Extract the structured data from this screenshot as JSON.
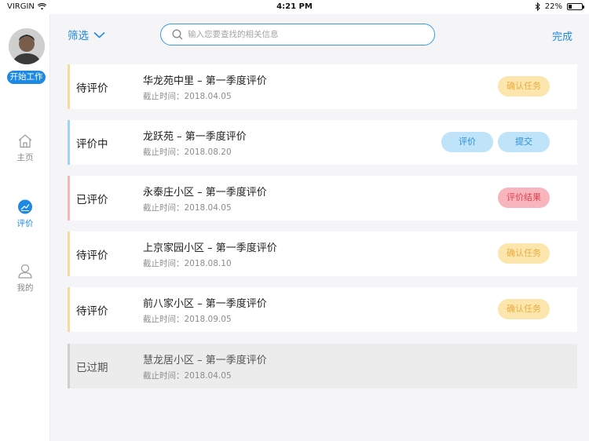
{
  "status_bar": {
    "carrier": "VIRGIN",
    "time": "4:21 PM",
    "battery": "22%",
    "battery_level": 0.22
  },
  "sidebar": {
    "start_button": "开始工作",
    "nav": [
      {
        "label": "主页",
        "icon": "home-icon",
        "active": false
      },
      {
        "label": "评价",
        "icon": "rating-icon",
        "active": true
      },
      {
        "label": "我的",
        "icon": "user-icon",
        "active": false
      }
    ]
  },
  "toolbar": {
    "filter_label": "筛选",
    "search_placeholder": "输入您要查找的相关信息",
    "done_label": "完成"
  },
  "tasks": [
    {
      "status": "待评价",
      "title": "华龙苑中里  –  第一季度评价",
      "deadline": "截止时间：2018.04.05",
      "actions": [
        "确认任务"
      ]
    },
    {
      "status": "评价中",
      "title": "龙跃苑  –  第一季度评价",
      "deadline": "截止时间：2018.08.20",
      "actions": [
        "评价",
        "提交"
      ]
    },
    {
      "status": "已评价",
      "title": "永泰庄小区  –  第一季度评价",
      "deadline": "截止时间：2018.04.05",
      "actions": [
        "评价结果"
      ]
    },
    {
      "status": "待评价",
      "title": "上京家园小区  –  第一季度评价",
      "deadline": "截止时间：2018.08.10",
      "actions": [
        "确认任务"
      ]
    },
    {
      "status": "待评价",
      "title": "前八家小区  –  第一季度评价",
      "deadline": "截止时间：2018.09.05",
      "actions": [
        "确认任务"
      ]
    },
    {
      "status": "已过期",
      "title": "慧龙居小区  –  第一季度评价",
      "deadline": "截止时间：2018.04.05",
      "actions": []
    }
  ],
  "colors": {
    "accent": "#1e88e5",
    "pending_accent": "#f2dca4",
    "in_progress_accent": "#9fd2f4",
    "done_accent": "#f4b6bc",
    "expired_accent": "#cfcfcf"
  }
}
